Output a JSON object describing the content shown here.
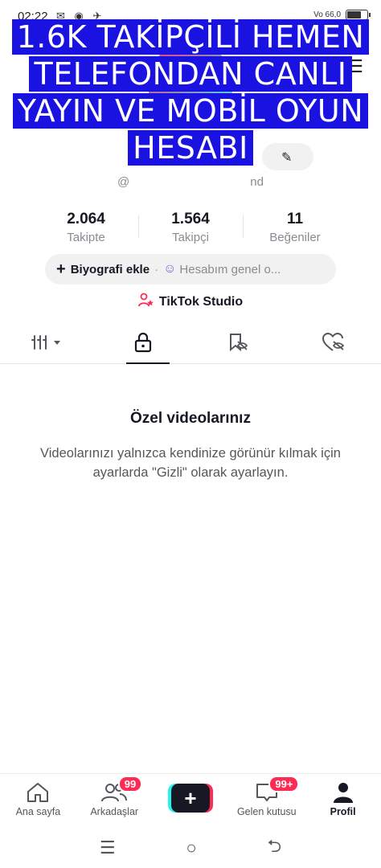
{
  "status_bar": {
    "time": "02:22",
    "left_icons": "✉ ◉ ✈",
    "network": "Vo 66,0",
    "battery_level": 0.64
  },
  "overlay": {
    "lines": [
      "1.6K TAKİPÇİLİ HEMEN",
      "TELEFONDAN CANLI",
      "YAYIN VE MOBİL OYUN",
      "HESABI"
    ]
  },
  "profile": {
    "username_prefix": "@",
    "username_suffix": "nd"
  },
  "stats": [
    {
      "value": "2.064",
      "label": "Takipte"
    },
    {
      "value": "1.564",
      "label": "Takipçi"
    },
    {
      "value": "11",
      "label": "Beğeniler"
    }
  ],
  "bio": {
    "add_label": "Biyografi ekle",
    "separator": "·",
    "account_label": "Hesabım genel o..."
  },
  "studio": {
    "label": "TikTok Studio"
  },
  "tabs": [
    {
      "name": "videos-grid",
      "icon": "grid-filter-icon"
    },
    {
      "name": "private",
      "icon": "lock-icon"
    },
    {
      "name": "reposts",
      "icon": "repost-hidden-icon"
    },
    {
      "name": "liked",
      "icon": "heart-hidden-icon"
    }
  ],
  "empty_state": {
    "title": "Özel videolarınız",
    "description": "Videolarınızı yalnızca kendinize görünür kılmak için ayarlarda \"Gizli\" olarak ayarlayın."
  },
  "bottom_nav": {
    "home": {
      "label": "Ana sayfa"
    },
    "friends": {
      "label": "Arkadaşlar",
      "badge": "99"
    },
    "create": {
      "label": "+"
    },
    "inbox": {
      "label": "Gelen kutusu",
      "badge": "99+"
    },
    "profile": {
      "label": "Profil"
    }
  },
  "system_nav": {
    "menu": "☰",
    "home": "○",
    "back": "⮌"
  }
}
